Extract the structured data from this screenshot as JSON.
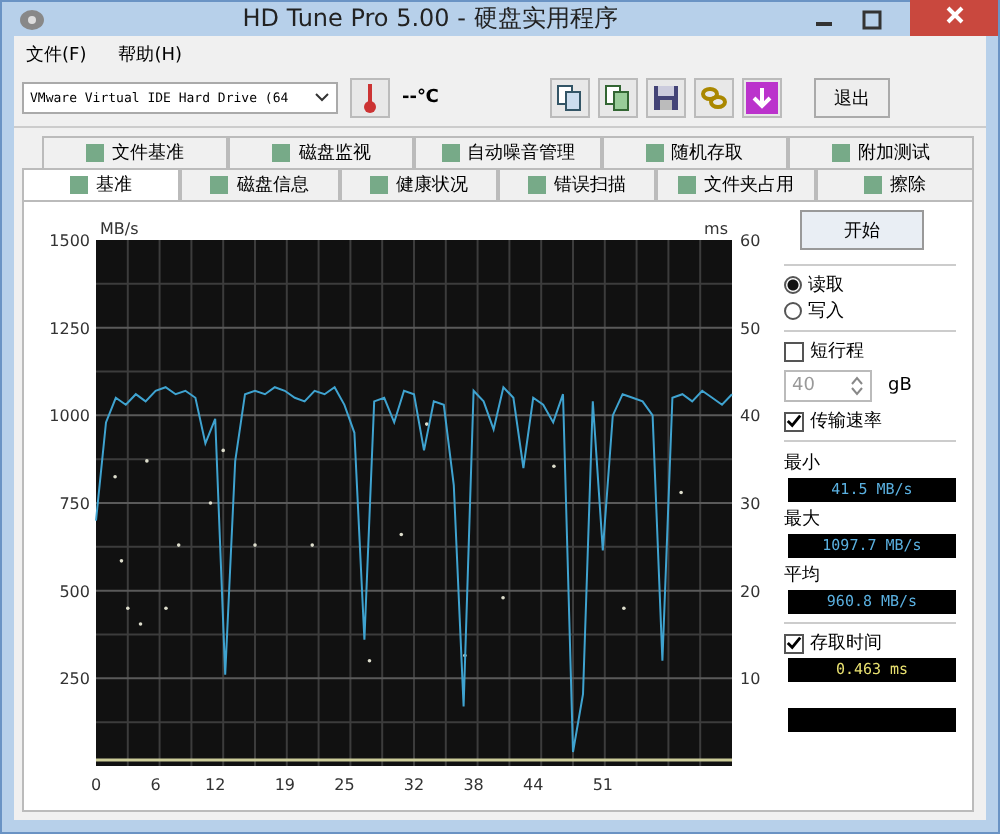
{
  "window": {
    "title": "HD Tune Pro 5.00 - 硬盘实用程序"
  },
  "menu": [
    "文件(F)",
    "帮助(H)"
  ],
  "toolbar": {
    "drive": "VMware Virtual IDE Hard Drive (64",
    "temperature": "--℃",
    "exit_button": "退出"
  },
  "tabs_row_1": [
    {
      "label": "文件基准",
      "selected": false
    },
    {
      "label": "磁盘监视",
      "selected": false
    },
    {
      "label": "自动噪音管理",
      "selected": false
    },
    {
      "label": "随机存取",
      "selected": false
    },
    {
      "label": "附加测试",
      "selected": false
    }
  ],
  "tabs_row_2": [
    {
      "label": "基准",
      "selected": true
    },
    {
      "label": "磁盘信息",
      "selected": false
    },
    {
      "label": "健康状况",
      "selected": false
    },
    {
      "label": "错误扫描",
      "selected": false
    },
    {
      "label": "文件夹占用",
      "selected": false
    },
    {
      "label": "擦除",
      "selected": false
    }
  ],
  "chart": {
    "y_right_unit": "ms",
    "y_right_ticks": [
      "60",
      "50",
      "40",
      "30",
      "20",
      "10"
    ],
    "chart_data": {
      "type": "line",
      "ylabel": "MB/s",
      "xlim": [
        0,
        64
      ],
      "ylim": [
        0,
        1500
      ],
      "xticks": [
        0,
        6,
        12,
        19,
        25,
        32,
        38,
        44,
        51
      ],
      "yticks": [
        250,
        500,
        750,
        1000,
        1250,
        1500
      ],
      "x": [
        0,
        1,
        2,
        3,
        4,
        5,
        6,
        7,
        8,
        9,
        10,
        11,
        12,
        13,
        14,
        15,
        16,
        17,
        18,
        19,
        20,
        21,
        22,
        23,
        24,
        25,
        26,
        27,
        28,
        29,
        30,
        31,
        32,
        33,
        34,
        35,
        36,
        37,
        38,
        39,
        40,
        41,
        42,
        43,
        44,
        45,
        46,
        47,
        48,
        49,
        50,
        51,
        52,
        53,
        54,
        55,
        56,
        57,
        58,
        59,
        60,
        61,
        62,
        63,
        64
      ],
      "series": [
        {
          "color": "#3fa3d0",
          "values": [
            700,
            980,
            1050,
            1030,
            1060,
            1040,
            1070,
            1080,
            1060,
            1070,
            1050,
            920,
            990,
            260,
            870,
            1060,
            1070,
            1060,
            1080,
            1070,
            1050,
            1040,
            1070,
            1060,
            1080,
            1030,
            950,
            360,
            1040,
            1050,
            980,
            1070,
            1060,
            900,
            1040,
            1030,
            800,
            170,
            1070,
            1040,
            960,
            1080,
            1050,
            850,
            1050,
            1030,
            980,
            1060,
            40,
            205,
            1040,
            615,
            1000,
            1060,
            1050,
            1040,
            1000,
            300,
            1050,
            1060,
            1040,
            1070,
            1050,
            1030,
            1060
          ]
        }
      ]
    }
  },
  "side": {
    "start_button": "开始",
    "modes": [
      {
        "label": "读取",
        "selected": true
      },
      {
        "label": "写入",
        "selected": false
      }
    ],
    "short_stroke": {
      "label": "短行程",
      "checked": false,
      "value": "40",
      "unit": "gB",
      "disabled": true
    },
    "transfer_rate": {
      "label": "传输速率",
      "checked": true
    },
    "readings": [
      {
        "label": "最小",
        "value": "41.5 MB/s"
      },
      {
        "label": "最大",
        "value": "1097.7 MB/s"
      },
      {
        "label": "平均",
        "value": "960.8 MB/s"
      }
    ],
    "access_time": {
      "label": "存取时间",
      "checked": true,
      "value": "0.463 ms"
    }
  }
}
